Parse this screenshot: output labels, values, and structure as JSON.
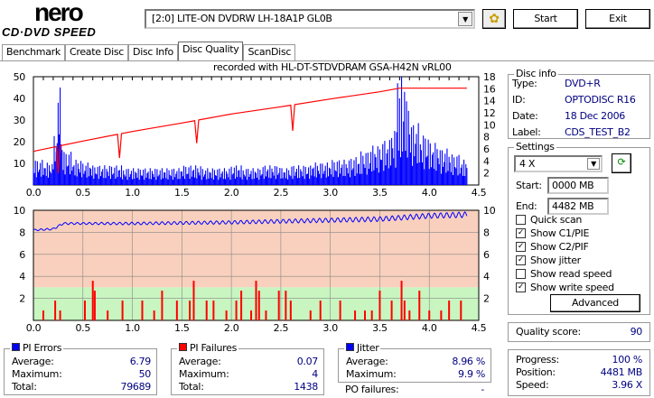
{
  "app": {
    "logo_top": "nero",
    "logo_bottom": "CD·DVD SPEED"
  },
  "toolbar": {
    "drive": "[2:0]  LITE-ON DVDRW LH-18A1P GL0B",
    "start": "Start",
    "exit": "Exit"
  },
  "tabs": [
    "Benchmark",
    "Create Disc",
    "Disc Info",
    "Disc Quality",
    "ScanDisc"
  ],
  "active_tab": "Disc Quality",
  "recorded_with": "recorded with HL-DT-STDVDRAM GSA-H42N  vRL00",
  "disc_info": {
    "title": "Disc info",
    "type_label": "Type:",
    "type": "DVD+R",
    "id_label": "ID:",
    "id": "OPTODISC R16",
    "date_label": "Date:",
    "date": "18 Dec 2006",
    "label_label": "Label:",
    "label": "CDS_TEST_B2"
  },
  "settings": {
    "title": "Settings",
    "speed": "4 X",
    "start_label": "Start:",
    "start": "0000 MB",
    "end_label": "End:",
    "end": "4482 MB",
    "checks": [
      {
        "label": "Quick scan",
        "checked": false
      },
      {
        "label": "Show C1/PIE",
        "checked": true
      },
      {
        "label": "Show C2/PIF",
        "checked": true
      },
      {
        "label": "Show jitter",
        "checked": true
      },
      {
        "label": "Show read speed",
        "checked": false
      },
      {
        "label": "Show write speed",
        "checked": true
      }
    ],
    "advanced": "Advanced"
  },
  "quality": {
    "label": "Quality score:",
    "value": "90"
  },
  "progress": {
    "progress_label": "Progress:",
    "progress": "100 %",
    "position_label": "Position:",
    "position": "4481 MB",
    "speed_label": "Speed:",
    "speed": "3.96 X"
  },
  "pi_errors": {
    "title": "PI Errors",
    "avg_label": "Average:",
    "avg": "6.79",
    "max_label": "Maximum:",
    "max": "50",
    "total_label": "Total:",
    "total": "79689",
    "color": "#0000ff"
  },
  "pi_failures": {
    "title": "PI Failures",
    "avg_label": "Average:",
    "avg": "0.07",
    "max_label": "Maximum:",
    "max": "4",
    "total_label": "Total:",
    "total": "1438",
    "color": "#ff0000"
  },
  "jitter": {
    "title": "Jitter",
    "avg_label": "Average:",
    "avg": "8.96 %",
    "max_label": "Maximum:",
    "max": "9.9 %",
    "po_label": "PO failures:",
    "po": "-",
    "color": "#0000ff"
  },
  "chart_data": [
    {
      "type": "bar",
      "name": "PI errors / write speed",
      "xlim": [
        0,
        4.5
      ],
      "ylim": [
        0,
        50
      ],
      "y2lim": [
        0,
        18
      ],
      "xticks": [
        "0.0",
        "0.5",
        "1.0",
        "1.5",
        "2.0",
        "2.5",
        "3.0",
        "3.5",
        "4.0",
        "4.5"
      ],
      "yticks": [
        "50",
        "40",
        "30",
        "20",
        "10"
      ],
      "y2ticks": [
        "18",
        "16",
        "14",
        "12",
        "10",
        "8",
        "6",
        "4",
        "2"
      ],
      "pi_x_step": 0.1,
      "pi_values": [
        9,
        8,
        18,
        12,
        9,
        8,
        7,
        7,
        7,
        6,
        6,
        6,
        6,
        6,
        6,
        7,
        7,
        6,
        6,
        6,
        7,
        6,
        6,
        7,
        7,
        6,
        7,
        7,
        8,
        8,
        9,
        9,
        10,
        12,
        14,
        16,
        20,
        30,
        22,
        18,
        15,
        13,
        11,
        9
      ],
      "pi_spikes": [
        [
          0.25,
          38
        ],
        [
          0.27,
          45
        ],
        [
          3.68,
          47
        ],
        [
          3.7,
          40
        ],
        [
          3.72,
          50
        ],
        [
          3.75,
          43
        ]
      ],
      "write_speed": [
        [
          0,
          5.6
        ],
        [
          0.5,
          7.3
        ],
        [
          1,
          8.9
        ],
        [
          1.5,
          10.3
        ],
        [
          2,
          11.8
        ],
        [
          2.5,
          13.0
        ],
        [
          3,
          14.3
        ],
        [
          3.5,
          15.5
        ],
        [
          3.7,
          16.1
        ],
        [
          4.38,
          16.1
        ]
      ],
      "write_dips": [
        [
          0.25,
          4.5
        ],
        [
          0.87,
          4.0
        ],
        [
          1.65,
          3.8
        ],
        [
          2.62,
          4.3
        ]
      ]
    },
    {
      "type": "bar",
      "name": "PI failures / jitter",
      "xlim": [
        0,
        4.5
      ],
      "ylim": [
        0,
        10
      ],
      "xticks": [
        "0.0",
        "0.5",
        "1.0",
        "1.5",
        "2.0",
        "2.5",
        "3.0",
        "3.5",
        "4.0",
        "4.5"
      ],
      "yticks": [
        "10",
        "8",
        "6",
        "4",
        "2"
      ],
      "jitter": [
        [
          0,
          8.2
        ],
        [
          0.2,
          8.3
        ],
        [
          0.3,
          8.8
        ],
        [
          1,
          8.8
        ],
        [
          2,
          8.9
        ],
        [
          3,
          9.1
        ],
        [
          3.5,
          9.2
        ],
        [
          4,
          9.5
        ],
        [
          4.38,
          9.6
        ]
      ],
      "pif": [
        [
          0.1,
          1
        ],
        [
          0.22,
          2
        ],
        [
          0.27,
          1
        ],
        [
          0.52,
          2
        ],
        [
          0.6,
          4
        ],
        [
          0.62,
          3
        ],
        [
          0.75,
          1
        ],
        [
          0.9,
          2
        ],
        [
          1.1,
          2
        ],
        [
          1.22,
          1
        ],
        [
          1.3,
          3
        ],
        [
          1.45,
          2
        ],
        [
          1.58,
          2
        ],
        [
          1.62,
          4
        ],
        [
          1.75,
          2
        ],
        [
          1.82,
          2
        ],
        [
          1.95,
          1
        ],
        [
          2.05,
          2
        ],
        [
          2.1,
          3
        ],
        [
          2.2,
          1
        ],
        [
          2.25,
          4
        ],
        [
          2.28,
          3
        ],
        [
          2.35,
          1
        ],
        [
          2.48,
          3
        ],
        [
          2.55,
          3
        ],
        [
          2.6,
          2
        ],
        [
          2.8,
          1
        ],
        [
          2.9,
          2
        ],
        [
          3.1,
          2
        ],
        [
          3.25,
          1
        ],
        [
          3.35,
          1
        ],
        [
          3.42,
          1
        ],
        [
          3.5,
          3
        ],
        [
          3.62,
          2
        ],
        [
          3.72,
          4
        ],
        [
          3.75,
          2
        ],
        [
          3.8,
          1
        ],
        [
          3.9,
          3
        ],
        [
          4.0,
          1
        ],
        [
          4.12,
          1
        ],
        [
          4.2,
          2
        ],
        [
          4.32,
          2
        ]
      ]
    }
  ]
}
